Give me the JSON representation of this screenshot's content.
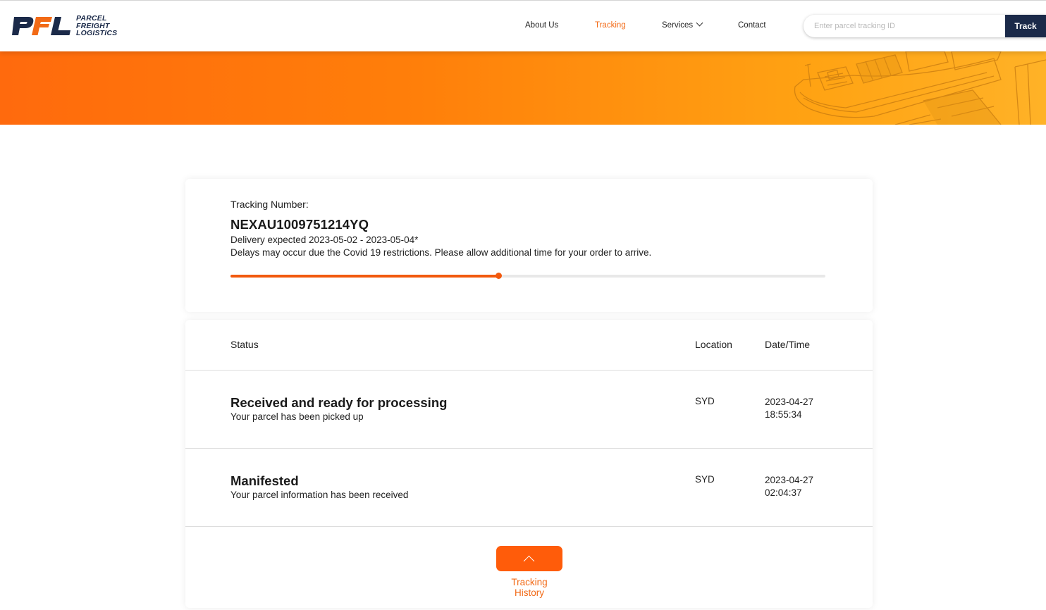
{
  "brand": {
    "logo_letters": "PFL",
    "name_lines": [
      "PARCEL",
      "FREIGHT",
      "LOGISTICS"
    ],
    "colors": {
      "navy": "#1b2a49",
      "orange": "#f26a16"
    }
  },
  "nav": {
    "items": [
      {
        "label": "About Us",
        "active": false
      },
      {
        "label": "Tracking",
        "active": true
      },
      {
        "label": "Services",
        "active": false,
        "has_dropdown": true
      },
      {
        "label": "Contact",
        "active": false
      }
    ]
  },
  "search": {
    "placeholder": "Enter parcel tracking ID",
    "value": "",
    "button_label": "Track"
  },
  "summary": {
    "label": "Tracking Number:",
    "tracking_number": "NEXAU1009751214YQ",
    "delivery_expected": "Delivery expected 2023-05-02 - 2023-05-04*",
    "delay_notice": "Delays may occur due the Covid 19 restrictions. Please allow additional time for your order to arrive.",
    "progress": 0.45
  },
  "history": {
    "headers": {
      "status": "Status",
      "location": "Location",
      "datetime": "Date/Time"
    },
    "rows": [
      {
        "title": "Received and ready for processing",
        "subtitle": "Your parcel has been picked up",
        "location": "SYD",
        "date": "2023-04-27",
        "time": "18:55:34"
      },
      {
        "title": "Manifested",
        "subtitle": "Your parcel information has been received",
        "location": "SYD",
        "date": "2023-04-27",
        "time": "02:04:37"
      }
    ],
    "toggle_label": "Tracking History",
    "toggle_icon": "chevron-up-icon"
  }
}
